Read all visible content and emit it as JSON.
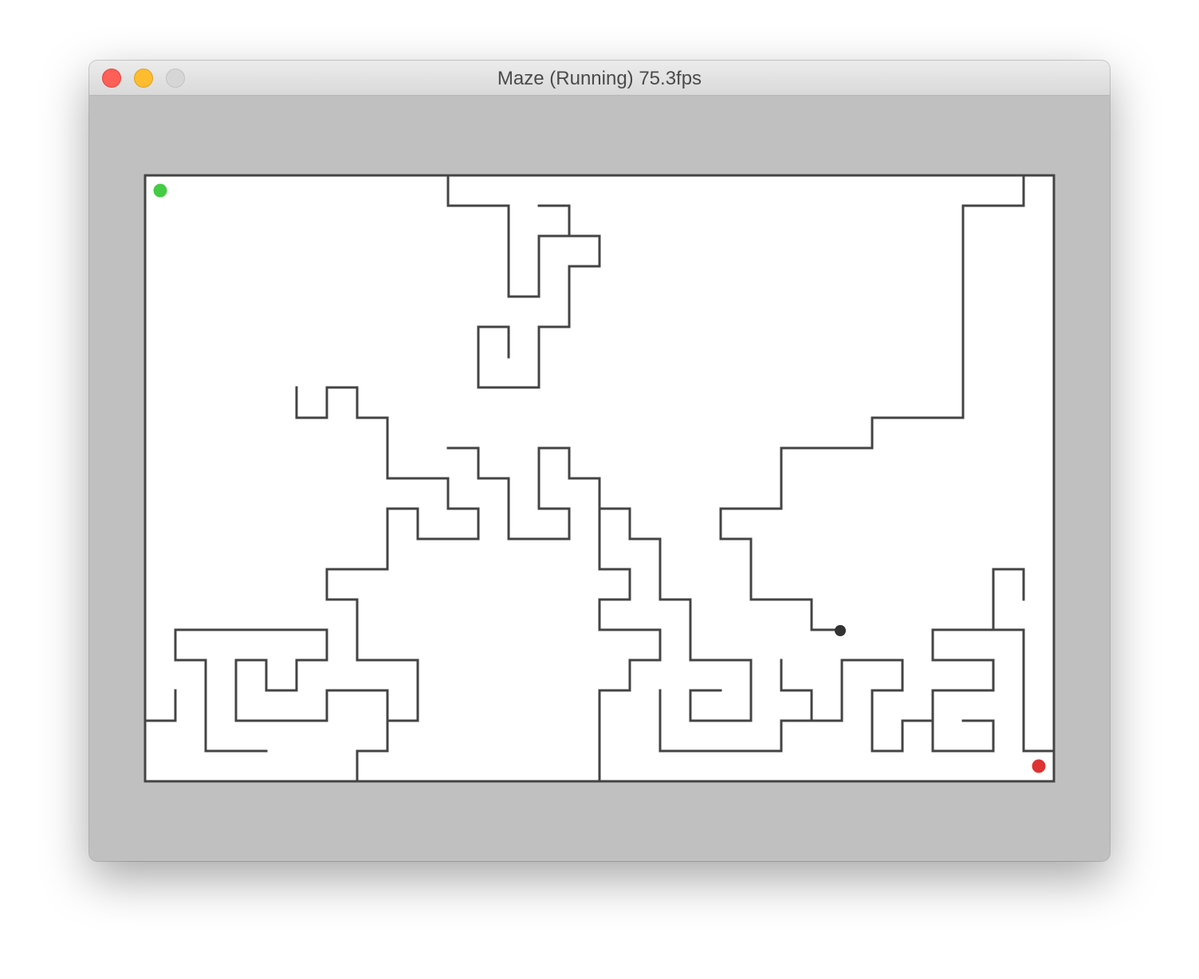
{
  "window": {
    "title": "Maze (Running) 75.3fps"
  },
  "maze": {
    "cols": 30,
    "rows": 20,
    "colors": {
      "wall": "#444444",
      "floor": "#ffffff",
      "start": "#44cc44",
      "goal": "#dd3333",
      "player": "#333333",
      "background": "#c0c0c0"
    },
    "start": [
      0,
      0
    ],
    "goal": [
      29,
      19
    ],
    "player": [
      22.5,
      15
    ],
    "walls": [
      [
        [
          0,
          0
        ],
        [
          30,
          0
        ]
      ],
      [
        [
          30,
          0
        ],
        [
          30,
          20
        ]
      ],
      [
        [
          30,
          20
        ],
        [
          0,
          20
        ]
      ],
      [
        [
          0,
          20
        ],
        [
          0,
          0
        ]
      ],
      [
        [
          10,
          0
        ],
        [
          10,
          1
        ]
      ],
      [
        [
          10,
          1
        ],
        [
          12,
          1
        ]
      ],
      [
        [
          12,
          1
        ],
        [
          12,
          4
        ]
      ],
      [
        [
          12,
          4
        ],
        [
          13,
          4
        ]
      ],
      [
        [
          13,
          4
        ],
        [
          13,
          2
        ]
      ],
      [
        [
          13,
          2
        ],
        [
          15,
          2
        ]
      ],
      [
        [
          15,
          2
        ],
        [
          15,
          3
        ]
      ],
      [
        [
          15,
          3
        ],
        [
          14,
          3
        ]
      ],
      [
        [
          14,
          3
        ],
        [
          14,
          5
        ]
      ],
      [
        [
          14,
          5
        ],
        [
          13,
          5
        ]
      ],
      [
        [
          13,
          5
        ],
        [
          13,
          7
        ]
      ],
      [
        [
          13,
          7
        ],
        [
          11,
          7
        ]
      ],
      [
        [
          11,
          7
        ],
        [
          11,
          5
        ]
      ],
      [
        [
          11,
          5
        ],
        [
          12,
          5
        ]
      ],
      [
        [
          12,
          5
        ],
        [
          12,
          6
        ]
      ],
      [
        [
          13,
          1
        ],
        [
          14,
          1
        ]
      ],
      [
        [
          14,
          1
        ],
        [
          14,
          2
        ]
      ],
      [
        [
          29,
          0
        ],
        [
          29,
          1
        ]
      ],
      [
        [
          29,
          1
        ],
        [
          27,
          1
        ]
      ],
      [
        [
          27,
          1
        ],
        [
          27,
          8
        ]
      ],
      [
        [
          27,
          8
        ],
        [
          24,
          8
        ]
      ],
      [
        [
          24,
          8
        ],
        [
          24,
          9
        ]
      ],
      [
        [
          24,
          9
        ],
        [
          21,
          9
        ]
      ],
      [
        [
          21,
          9
        ],
        [
          21,
          11
        ]
      ],
      [
        [
          21,
          11
        ],
        [
          19,
          11
        ]
      ],
      [
        [
          19,
          11
        ],
        [
          19,
          12
        ]
      ],
      [
        [
          19,
          12
        ],
        [
          20,
          12
        ]
      ],
      [
        [
          20,
          12
        ],
        [
          20,
          14
        ]
      ],
      [
        [
          20,
          14
        ],
        [
          22,
          14
        ]
      ],
      [
        [
          22,
          14
        ],
        [
          22,
          15
        ]
      ],
      [
        [
          22,
          15
        ],
        [
          23,
          15
        ]
      ],
      [
        [
          5,
          7
        ],
        [
          5,
          8
        ]
      ],
      [
        [
          5,
          8
        ],
        [
          6,
          8
        ]
      ],
      [
        [
          6,
          8
        ],
        [
          6,
          7
        ]
      ],
      [
        [
          6,
          7
        ],
        [
          7,
          7
        ]
      ],
      [
        [
          7,
          7
        ],
        [
          7,
          8
        ]
      ],
      [
        [
          7,
          8
        ],
        [
          8,
          8
        ]
      ],
      [
        [
          8,
          8
        ],
        [
          8,
          10
        ]
      ],
      [
        [
          8,
          10
        ],
        [
          10,
          10
        ]
      ],
      [
        [
          10,
          10
        ],
        [
          10,
          11
        ]
      ],
      [
        [
          10,
          11
        ],
        [
          11,
          11
        ]
      ],
      [
        [
          11,
          11
        ],
        [
          11,
          12
        ]
      ],
      [
        [
          11,
          12
        ],
        [
          9,
          12
        ]
      ],
      [
        [
          9,
          12
        ],
        [
          9,
          11
        ]
      ],
      [
        [
          9,
          11
        ],
        [
          8,
          11
        ]
      ],
      [
        [
          8,
          11
        ],
        [
          8,
          13
        ]
      ],
      [
        [
          8,
          13
        ],
        [
          6,
          13
        ]
      ],
      [
        [
          6,
          13
        ],
        [
          6,
          14
        ]
      ],
      [
        [
          6,
          14
        ],
        [
          7,
          14
        ]
      ],
      [
        [
          7,
          14
        ],
        [
          7,
          16
        ]
      ],
      [
        [
          7,
          16
        ],
        [
          9,
          16
        ]
      ],
      [
        [
          9,
          16
        ],
        [
          9,
          18
        ]
      ],
      [
        [
          9,
          18
        ],
        [
          8,
          18
        ]
      ],
      [
        [
          10,
          9
        ],
        [
          11,
          9
        ]
      ],
      [
        [
          11,
          9
        ],
        [
          11,
          10
        ]
      ],
      [
        [
          11,
          10
        ],
        [
          12,
          10
        ]
      ],
      [
        [
          12,
          10
        ],
        [
          12,
          12
        ]
      ],
      [
        [
          12,
          12
        ],
        [
          14,
          12
        ]
      ],
      [
        [
          14,
          12
        ],
        [
          14,
          11
        ]
      ],
      [
        [
          14,
          11
        ],
        [
          13,
          11
        ]
      ],
      [
        [
          13,
          11
        ],
        [
          13,
          9
        ]
      ],
      [
        [
          13,
          9
        ],
        [
          14,
          9
        ]
      ],
      [
        [
          14,
          9
        ],
        [
          14,
          10
        ]
      ],
      [
        [
          14,
          10
        ],
        [
          15,
          10
        ]
      ],
      [
        [
          15,
          10
        ],
        [
          15,
          13
        ]
      ],
      [
        [
          15,
          13
        ],
        [
          16,
          13
        ]
      ],
      [
        [
          16,
          13
        ],
        [
          16,
          14
        ]
      ],
      [
        [
          16,
          14
        ],
        [
          15,
          14
        ]
      ],
      [
        [
          15,
          14
        ],
        [
          15,
          15
        ]
      ],
      [
        [
          15,
          15
        ],
        [
          17,
          15
        ]
      ],
      [
        [
          17,
          15
        ],
        [
          17,
          16
        ]
      ],
      [
        [
          17,
          16
        ],
        [
          16,
          16
        ]
      ],
      [
        [
          16,
          16
        ],
        [
          16,
          17
        ]
      ],
      [
        [
          16,
          17
        ],
        [
          15,
          17
        ]
      ],
      [
        [
          15,
          17
        ],
        [
          15,
          20
        ]
      ],
      [
        [
          15,
          11
        ],
        [
          16,
          11
        ]
      ],
      [
        [
          16,
          11
        ],
        [
          16,
          12
        ]
      ],
      [
        [
          16,
          12
        ],
        [
          17,
          12
        ]
      ],
      [
        [
          17,
          12
        ],
        [
          17,
          14
        ]
      ],
      [
        [
          17,
          14
        ],
        [
          18,
          14
        ]
      ],
      [
        [
          18,
          14
        ],
        [
          18,
          16
        ]
      ],
      [
        [
          18,
          16
        ],
        [
          20,
          16
        ]
      ],
      [
        [
          20,
          16
        ],
        [
          20,
          18
        ]
      ],
      [
        [
          20,
          18
        ],
        [
          18,
          18
        ]
      ],
      [
        [
          18,
          18
        ],
        [
          18,
          17
        ]
      ],
      [
        [
          18,
          17
        ],
        [
          19,
          17
        ]
      ],
      [
        [
          1,
          15
        ],
        [
          6,
          15
        ]
      ],
      [
        [
          6,
          15
        ],
        [
          6,
          16
        ]
      ],
      [
        [
          6,
          16
        ],
        [
          5,
          16
        ]
      ],
      [
        [
          5,
          16
        ],
        [
          5,
          17
        ]
      ],
      [
        [
          5,
          17
        ],
        [
          4,
          17
        ]
      ],
      [
        [
          4,
          17
        ],
        [
          4,
          16
        ]
      ],
      [
        [
          4,
          16
        ],
        [
          3,
          16
        ]
      ],
      [
        [
          3,
          16
        ],
        [
          3,
          18
        ]
      ],
      [
        [
          3,
          18
        ],
        [
          6,
          18
        ]
      ],
      [
        [
          6,
          18
        ],
        [
          6,
          17
        ]
      ],
      [
        [
          6,
          17
        ],
        [
          8,
          17
        ]
      ],
      [
        [
          8,
          17
        ],
        [
          8,
          19
        ]
      ],
      [
        [
          8,
          19
        ],
        [
          7,
          19
        ]
      ],
      [
        [
          7,
          19
        ],
        [
          7,
          20
        ]
      ],
      [
        [
          1,
          15
        ],
        [
          1,
          16
        ]
      ],
      [
        [
          1,
          16
        ],
        [
          2,
          16
        ]
      ],
      [
        [
          2,
          16
        ],
        [
          2,
          19
        ]
      ],
      [
        [
          2,
          19
        ],
        [
          4,
          19
        ]
      ],
      [
        [
          0,
          18
        ],
        [
          1,
          18
        ]
      ],
      [
        [
          1,
          18
        ],
        [
          1,
          17
        ]
      ],
      [
        [
          17,
          17
        ],
        [
          17,
          19
        ]
      ],
      [
        [
          17,
          19
        ],
        [
          21,
          19
        ]
      ],
      [
        [
          21,
          19
        ],
        [
          21,
          18
        ]
      ],
      [
        [
          21,
          18
        ],
        [
          23,
          18
        ]
      ],
      [
        [
          23,
          18
        ],
        [
          23,
          16
        ]
      ],
      [
        [
          23,
          16
        ],
        [
          25,
          16
        ]
      ],
      [
        [
          25,
          16
        ],
        [
          25,
          17
        ]
      ],
      [
        [
          25,
          17
        ],
        [
          24,
          17
        ]
      ],
      [
        [
          24,
          17
        ],
        [
          24,
          19
        ]
      ],
      [
        [
          24,
          19
        ],
        [
          25,
          19
        ]
      ],
      [
        [
          25,
          19
        ],
        [
          25,
          18
        ]
      ],
      [
        [
          25,
          18
        ],
        [
          26,
          18
        ]
      ],
      [
        [
          21,
          16
        ],
        [
          21,
          17
        ]
      ],
      [
        [
          21,
          17
        ],
        [
          22,
          17
        ]
      ],
      [
        [
          22,
          17
        ],
        [
          22,
          18
        ]
      ],
      [
        [
          26,
          15
        ],
        [
          28,
          15
        ]
      ],
      [
        [
          28,
          15
        ],
        [
          28,
          13
        ]
      ],
      [
        [
          28,
          13
        ],
        [
          29,
          13
        ]
      ],
      [
        [
          29,
          13
        ],
        [
          29,
          14
        ]
      ],
      [
        [
          26,
          15
        ],
        [
          26,
          16
        ]
      ],
      [
        [
          26,
          16
        ],
        [
          28,
          16
        ]
      ],
      [
        [
          28,
          16
        ],
        [
          28,
          17
        ]
      ],
      [
        [
          28,
          17
        ],
        [
          26,
          17
        ]
      ],
      [
        [
          26,
          17
        ],
        [
          26,
          19
        ]
      ],
      [
        [
          26,
          19
        ],
        [
          28,
          19
        ]
      ],
      [
        [
          28,
          19
        ],
        [
          28,
          18
        ]
      ],
      [
        [
          28,
          18
        ],
        [
          27,
          18
        ]
      ],
      [
        [
          28,
          15
        ],
        [
          29,
          15
        ]
      ],
      [
        [
          29,
          15
        ],
        [
          29,
          19
        ]
      ],
      [
        [
          29,
          19
        ],
        [
          30,
          19
        ]
      ]
    ]
  }
}
